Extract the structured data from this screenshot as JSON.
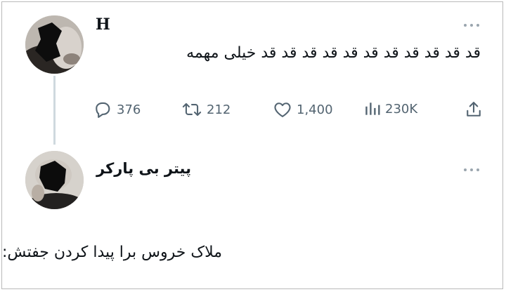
{
  "tweets": [
    {
      "author": "H",
      "text": "قد قد قد قد قد قد قد قد قد قد قد خیلی مهمه",
      "replies": "376",
      "retweets": "212",
      "likes": "1,400",
      "views": "230K"
    },
    {
      "author": "پیتر بی پارکر",
      "text": "ملاک خروس برا پیدا کردن جفتش:"
    }
  ],
  "icons": {
    "reply": "reply-icon",
    "retweet": "retweet-icon",
    "like": "heart-icon",
    "views": "views-icon",
    "share": "share-icon",
    "more": "more-icon"
  },
  "colors": {
    "text": "#0f1419",
    "muted": "#536471",
    "thread_line": "#cfd9de"
  }
}
